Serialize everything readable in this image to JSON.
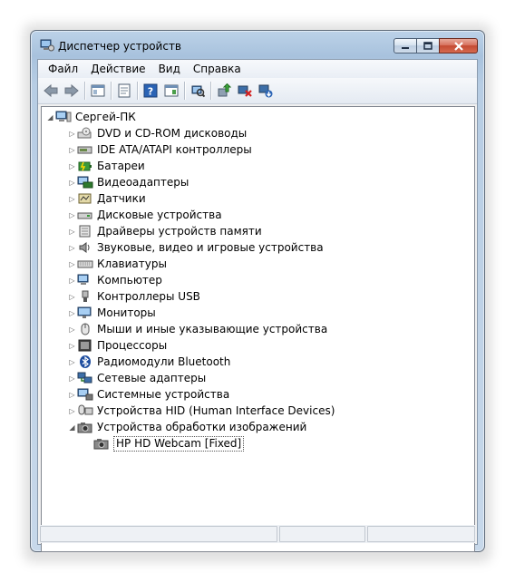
{
  "window": {
    "title": "Диспетчер устройств"
  },
  "menu": [
    "Файл",
    "Действие",
    "Вид",
    "Справка"
  ],
  "toolbar": [
    "back-arrow-icon",
    "forward-arrow-icon",
    "show-hide-console-tree-icon",
    "properties-icon",
    "help-icon",
    "console-tree-view-icon",
    "scan-hardware-changes-icon",
    "update-driver-icon",
    "disable-device-icon",
    "uninstall-device-icon"
  ],
  "tree": {
    "root": "Сергей-ПК",
    "categories": [
      "DVD и CD-ROM дисководы",
      "IDE ATA/ATAPI контроллеры",
      "Батареи",
      "Видеоадаптеры",
      "Датчики",
      "Дисковые устройства",
      "Драйверы устройств памяти",
      "Звуковые, видео и игровые устройства",
      "Клавиатуры",
      "Компьютер",
      "Контроллеры USB",
      "Мониторы",
      "Мыши и иные указывающие устройства",
      "Процессоры",
      "Радиомодули Bluetooth",
      "Сетевые адаптеры",
      "Системные устройства",
      "Устройства HID (Human Interface Devices)",
      "Устройства обработки изображений"
    ],
    "expanded_category": "Устройства обработки изображений",
    "selected_device": "HP HD Webcam [Fixed]"
  },
  "colors": {
    "title_gradient": "#b7cde4",
    "close_button": "#c44a32",
    "selection_border": "#555555"
  }
}
